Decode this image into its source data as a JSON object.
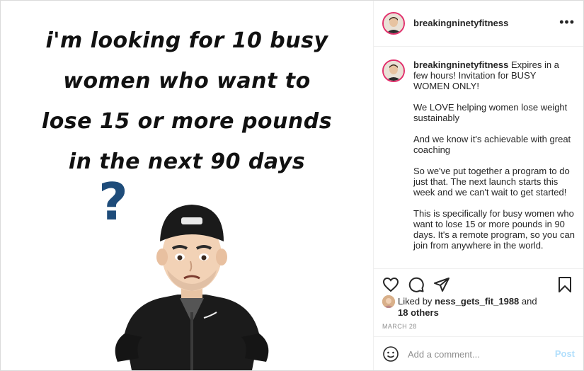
{
  "image": {
    "headline_lines": [
      "I'M LOOKING FOR 10 BUSY",
      "WOMEN WHO WANT TO",
      "LOSE 15 OR MORE POUNDS",
      "IN THE NEXT 90 DAYS"
    ],
    "question_mark": "?",
    "question_color": "#1e4c7a"
  },
  "header": {
    "username": "breakingninetyfitness",
    "more_label": "•••"
  },
  "caption": {
    "username": "breakingninetyfitness",
    "intro": " Expires in a few hours! Invitation for BUSY WOMEN ONLY!",
    "paragraphs": [
      "We LOVE helping women lose weight sustainably",
      "And we know it's achievable with great coaching",
      "So we've put together a program to do just that. The next launch starts this week and we can't wait to get started!",
      "This is specifically for busy women who want to lose 15 or more pounds in 90 days. It's a remote program, so you can join from anywhere in the world."
    ]
  },
  "actions": {
    "like": "heart-icon",
    "comment": "comment-icon",
    "share": "paper-plane-icon",
    "save": "bookmark-icon"
  },
  "likes": {
    "prefix": "Liked by ",
    "user": "ness_gets_fit_1988",
    "joiner": " and",
    "others": "18 others"
  },
  "date": "MARCH 28",
  "comment": {
    "placeholder": "Add a comment...",
    "post_label": "Post"
  },
  "colors": {
    "ring": "#e1306c",
    "post_disabled": "#b2dffc",
    "text": "#262626",
    "muted": "#8e8e8e"
  }
}
